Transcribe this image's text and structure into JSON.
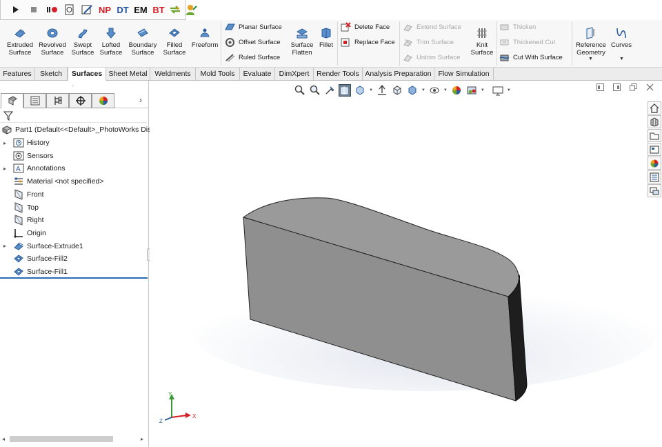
{
  "macro_toolbar": {
    "np": "NP",
    "dt": "DT",
    "em": "EM",
    "bt": "BT"
  },
  "command_manager": {
    "extruded_surface": [
      "Extruded",
      "Surface"
    ],
    "revolved_surface": [
      "Revolved",
      "Surface"
    ],
    "swept_surface": [
      "Swept",
      "Surface"
    ],
    "lofted_surface": [
      "Lofted",
      "Surface"
    ],
    "boundary_surface": [
      "Boundary",
      "Surface"
    ],
    "filled_surface": [
      "Filled",
      "Surface"
    ],
    "freeform": "Freeform",
    "planar_surface": "Planar Surface",
    "offset_surface": "Offset Surface",
    "ruled_surface": "Ruled Surface",
    "surface_flatten": [
      "Surface",
      "Flatten"
    ],
    "fillet": "Fillet",
    "delete_face": "Delete Face",
    "replace_face": "Replace Face",
    "extend_surface": "Extend Surface",
    "trim_surface": "Trim Surface",
    "untrim_surface": "Untrim Surface",
    "knit_surface": [
      "Knit",
      "Surface"
    ],
    "thicken": "Thicken",
    "thickened_cut": "Thickened Cut",
    "cut_with_surface": "Cut With Surface",
    "reference_geometry": [
      "Reference",
      "Geometry"
    ],
    "curves": "Curves"
  },
  "tabs": [
    "Features",
    "Sketch",
    "Surfaces",
    "Sheet Metal",
    "Weldments",
    "Mold Tools",
    "Evaluate",
    "DimXpert",
    "Render Tools",
    "Analysis Preparation",
    "Flow Simulation"
  ],
  "active_tab": "Surfaces",
  "feature_tree": {
    "root": "Part1  (Default<<Default>_PhotoWorks Dis",
    "items": [
      {
        "label": "History",
        "icon": "history-icon",
        "expandable": true
      },
      {
        "label": "Sensors",
        "icon": "sensors-icon",
        "expandable": false
      },
      {
        "label": "Annotations",
        "icon": "annotations-icon",
        "expandable": true
      },
      {
        "label": "Material <not specified>",
        "icon": "material-icon",
        "expandable": false
      },
      {
        "label": "Front",
        "icon": "plane-icon",
        "expandable": false
      },
      {
        "label": "Top",
        "icon": "plane-icon",
        "expandable": false
      },
      {
        "label": "Right",
        "icon": "plane-icon",
        "expandable": false
      },
      {
        "label": "Origin",
        "icon": "origin-icon",
        "expandable": false
      },
      {
        "label": "Surface-Extrude1",
        "icon": "surface-extrude-icon",
        "expandable": true
      },
      {
        "label": "Surface-Fill2",
        "icon": "surface-fill-icon",
        "expandable": false
      },
      {
        "label": "Surface-Fill1",
        "icon": "surface-fill-icon",
        "expandable": false
      }
    ]
  },
  "triad": {
    "x": "X",
    "y": "Y",
    "z": "Z"
  },
  "colors": {
    "accent": "#2a6ab5",
    "red_text": "#d32027",
    "blue_text": "#1f4f9e",
    "model_face": "#8f8f8f",
    "model_top": "#9a9a9a",
    "model_side": "#1e1e1e"
  }
}
